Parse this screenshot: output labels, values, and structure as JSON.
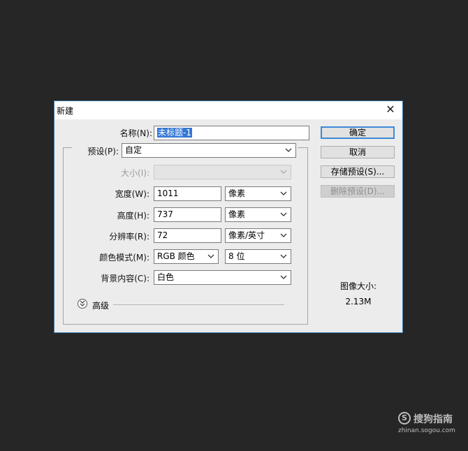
{
  "dialog": {
    "title": "新建",
    "close_icon": "close-icon"
  },
  "form": {
    "name_label": "名称(N):",
    "name_value": "未标题-1",
    "preset_label": "预设(P):",
    "preset_value": "自定",
    "size_label": "大小(I):",
    "size_value": "",
    "width_label": "宽度(W):",
    "width_value": "1011",
    "width_unit": "像素",
    "height_label": "高度(H):",
    "height_value": "737",
    "height_unit": "像素",
    "resolution_label": "分辨率(R):",
    "resolution_value": "72",
    "resolution_unit": "像素/英寸",
    "color_mode_label": "颜色模式(M):",
    "color_mode_value": "RGB 颜色",
    "bit_depth_value": "8 位",
    "background_label": "背景内容(C):",
    "background_value": "白色",
    "advanced_label": "高级"
  },
  "buttons": {
    "ok": "确定",
    "cancel": "取消",
    "save_preset": "存储预设(S)...",
    "delete_preset": "删除预设(D)..."
  },
  "image_size": {
    "label": "图像大小:",
    "value": "2.13M"
  },
  "watermark": {
    "logo": "S",
    "name": "搜狗指南",
    "url": "zhinan.sogou.com"
  },
  "colors": {
    "background": "#262626",
    "dialog": "#ececec",
    "accent": "#3c8ad9",
    "selection": "#3477d4"
  }
}
